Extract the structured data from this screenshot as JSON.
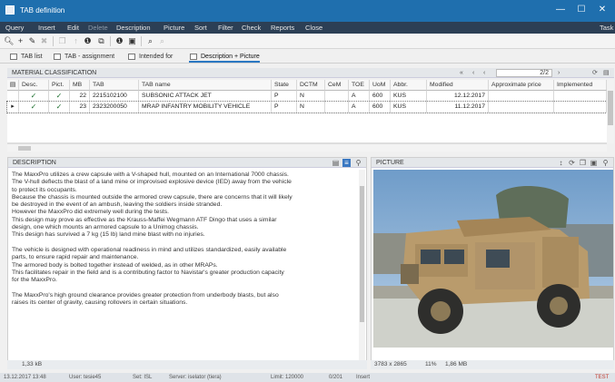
{
  "window": {
    "title": "TAB definition",
    "controls": {
      "minimize": "—",
      "maximize": "☐",
      "close": "✕"
    }
  },
  "menu": {
    "items": [
      "Query",
      "Insert",
      "Edit",
      "Delete",
      "Description",
      "Picture",
      "Sort",
      "Filter",
      "Check",
      "Reports",
      "Close"
    ],
    "right": "Task"
  },
  "toolbar": {
    "icons": [
      "search-icon",
      "add-icon",
      "edit-icon",
      "delete-icon",
      "copy-icon",
      "export-icon",
      "info-icon",
      "duplicate-icon",
      "info-alt-icon",
      "save-icon",
      "zoom-icon",
      "zoom-out-icon"
    ]
  },
  "tabs": [
    "TAB list",
    "TAB - assignment",
    "Intended for",
    "Description + Picture"
  ],
  "classification": {
    "title": "MATERIAL CLASSIFICATION",
    "pager": "2/2",
    "columns": [
      "Desc.",
      "Pict.",
      "MB",
      "TAB",
      "TAB name",
      "State",
      "DCTM",
      "CeM",
      "TOE",
      "UoM",
      "Abbr.",
      "Modified",
      "Approximate price",
      "Implemented"
    ],
    "rows": [
      {
        "desc": "✓",
        "pict": "✓",
        "mb": "22",
        "tab": "2215102100",
        "name": "SUBSONIC ATTACK JET",
        "state": "P",
        "dctm": "N",
        "cem": "",
        "toe": "A",
        "uom": "600",
        "abbr": "KUS",
        "modified": "12.12.2017",
        "price": "",
        "implemented": ""
      },
      {
        "desc": "✓",
        "pict": "✓",
        "mb": "23",
        "tab": "2323200050",
        "name": "MRAP INFANTRY MOBILITY VEHICLE",
        "state": "P",
        "dctm": "N",
        "cem": "",
        "toe": "A",
        "uom": "600",
        "abbr": "KUS",
        "modified": "11.12.2017",
        "price": "",
        "implemented": ""
      }
    ]
  },
  "description": {
    "title": "DESCRIPTION",
    "lines": [
      "The MaxxPro utilizes a crew capsule with a V-shaped hull, mounted on an International 7000 chassis.",
      "The V-hull deflects the blast of a land mine or improvised explosive device (IED) away from the vehicle",
      "to protect its occupants.",
      "Because the chassis is mounted outside the armored crew capsule, there are concerns that it will likely",
      "be destroyed in the event of an ambush, leaving the soldiers inside stranded.",
      "However the MaxxPro did extremely well during the tests.",
      "This design may prove as effective as the Krauss-Maffei Wegmann ATF Dingo that uses a similar",
      "design, one which mounts an armored capsule to a Unimog chassis.",
      "This design has survived a 7 kg (15 lb) land mine blast with no injuries.",
      "",
      "The vehicle is designed with operational readiness in mind and utilizes standardized, easily available",
      "parts, to ensure rapid repair and maintenance.",
      "The armored body is bolted together instead of welded, as in other MRAPs.",
      "This facilitates repair in the field and is a contributing factor to Navistar's greater production capacity",
      "for the MaxxPro.",
      "",
      "The MaxxPro's high ground clearance provides greater protection from underbody blasts, but also",
      "raises its center of gravity, causing rollovers in certain situations."
    ],
    "size": "1,33 kB"
  },
  "picture": {
    "title": "PICTURE",
    "dimensions": "3783 x 2865",
    "zoom": "11%",
    "filesize": "1,86 MB"
  },
  "status": {
    "datetime": "13.12.2017  13:48",
    "user": "User: tesie45",
    "set": "Set: ISL",
    "server": "Server: iselator (tiera)",
    "limit": "Limit: 120000",
    "count": "0/201",
    "mode": "Insert",
    "flag": "TEST"
  },
  "colors": {
    "titlebar": "#1f6fae",
    "menubar": "#2c3f55",
    "accent": "#2b78c2",
    "check": "#1d6f2e"
  }
}
